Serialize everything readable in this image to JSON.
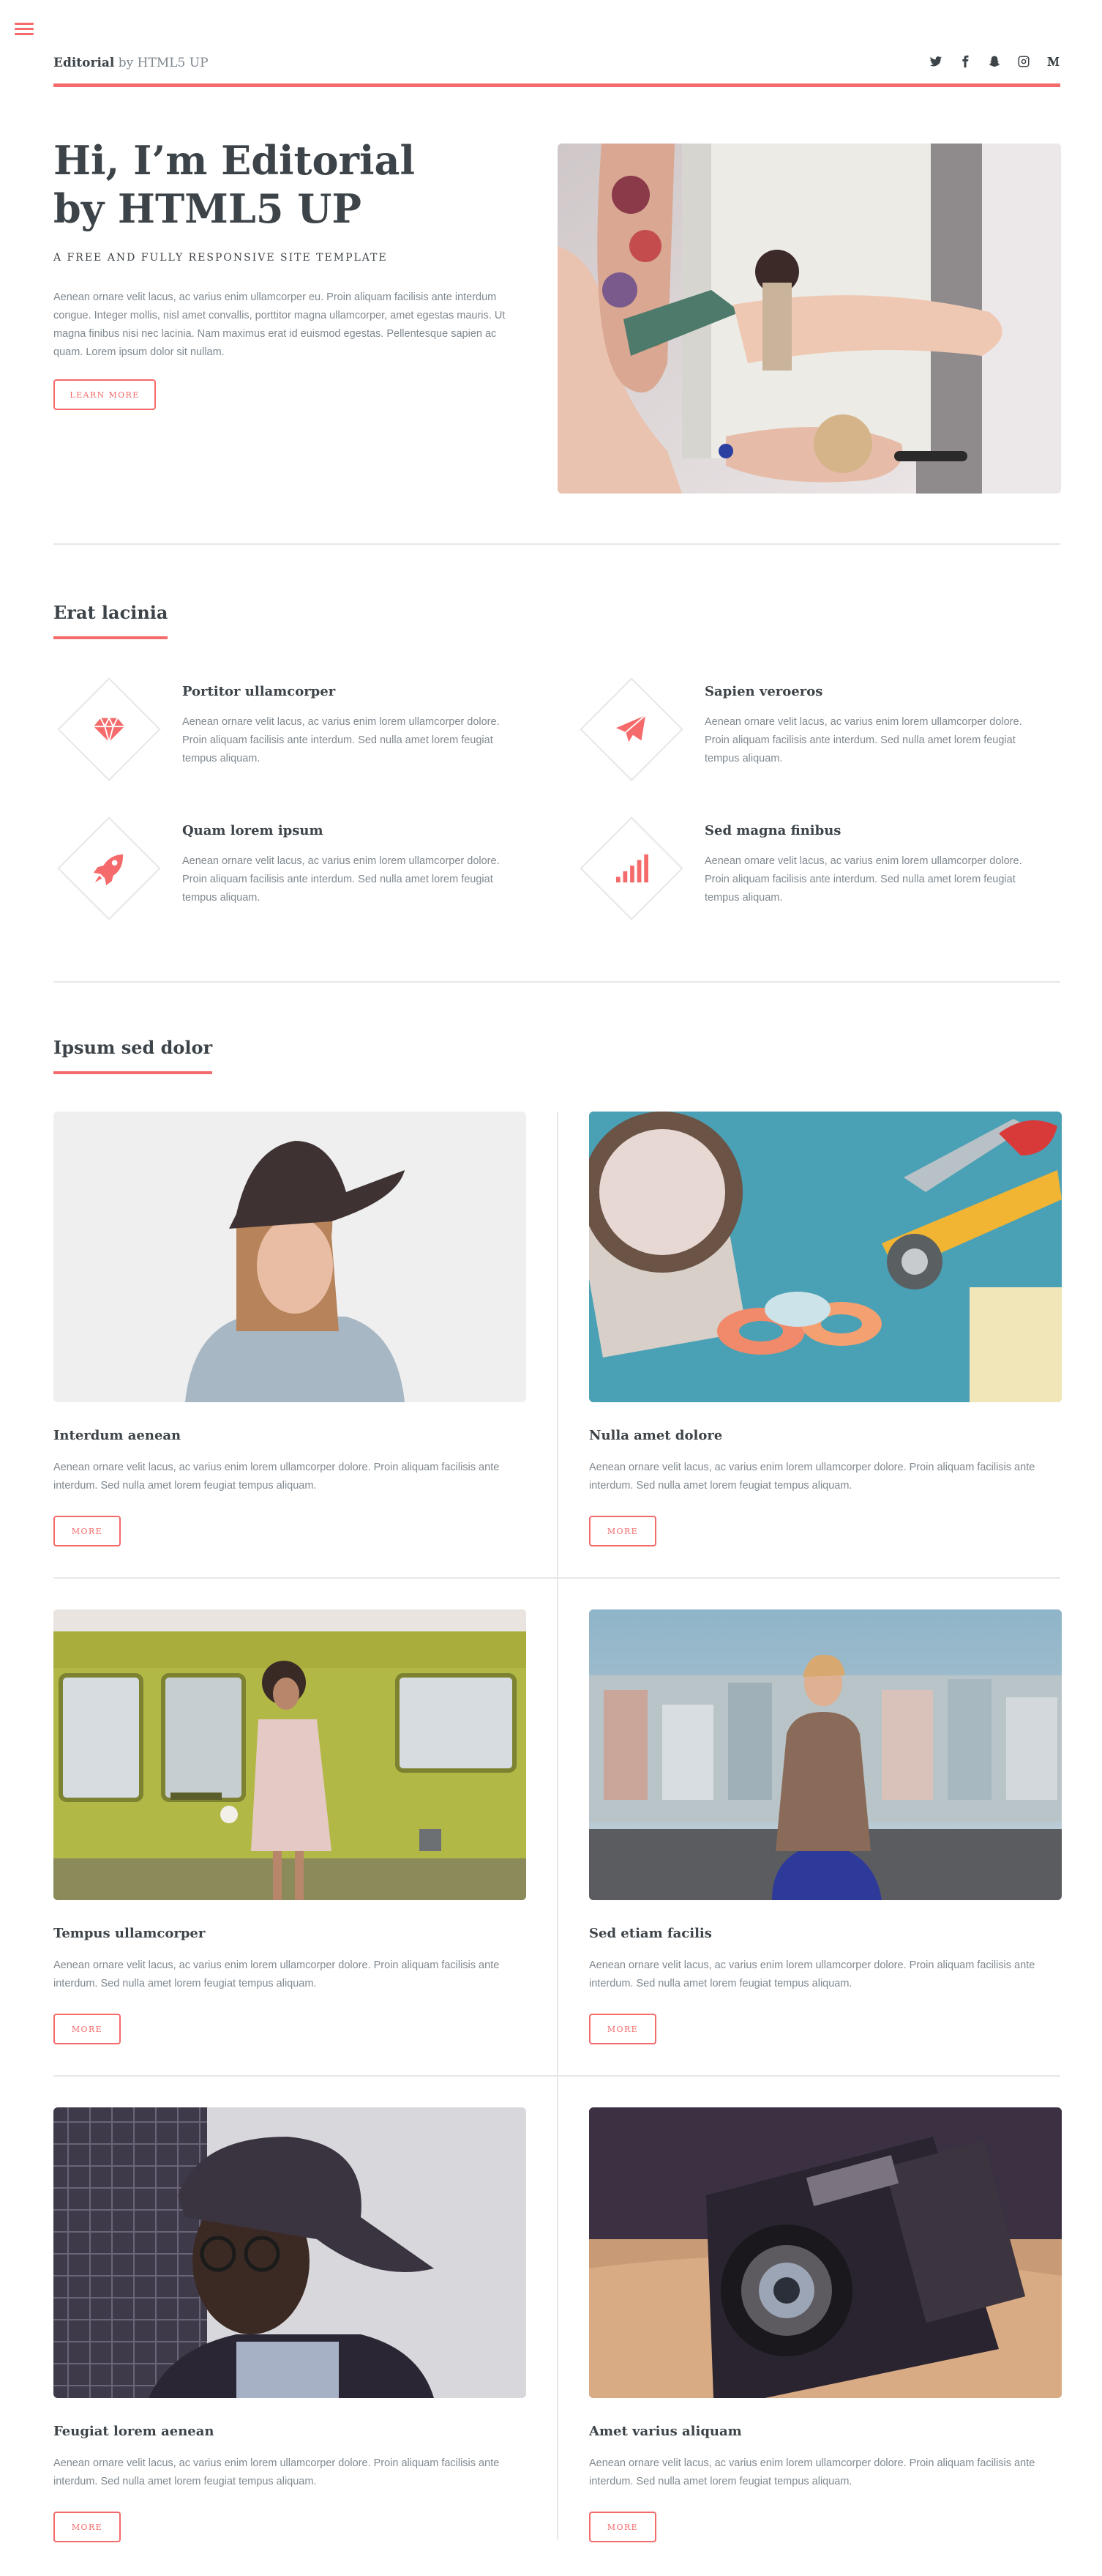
{
  "header": {
    "logo_brand": "Editorial",
    "logo_suffix": " by HTML5 UP"
  },
  "social_icons": [
    "twitter-icon",
    "facebook-icon",
    "snapchat-icon",
    "instagram-icon",
    "medium-icon"
  ],
  "banner": {
    "title_line1": "Hi, I’m Editorial",
    "title_line2": "by HTML5 UP",
    "subtitle": "A FREE AND FULLY RESPONSIVE SITE TEMPLATE",
    "text": "Aenean ornare velit lacus, ac varius enim ullamcorper eu. Proin aliquam facilisis ante interdum congue. Integer mollis, nisl amet convallis, porttitor magna ullamcorper, amet egestas mauris. Ut magna finibus nisi nec lacinia. Nam maximus erat id euismod egestas. Pellentesque sapien ac quam. Lorem ipsum dolor sit nullam.",
    "button": "LEARN MORE"
  },
  "features": {
    "title": "Erat lacinia",
    "items": [
      {
        "title": "Portitor ullamcorper",
        "icon": "diamond-gem-icon",
        "text": "Aenean ornare velit lacus, ac varius enim lorem ullamcorper dolore. Proin aliquam facilisis ante interdum. Sed nulla amet lorem feugiat tempus aliquam."
      },
      {
        "title": "Sapien veroeros",
        "icon": "paper-plane-icon",
        "text": "Aenean ornare velit lacus, ac varius enim lorem ullamcorper dolore. Proin aliquam facilisis ante interdum. Sed nulla amet lorem feugiat tempus aliquam."
      },
      {
        "title": "Quam lorem ipsum",
        "icon": "rocket-icon",
        "text": "Aenean ornare velit lacus, ac varius enim lorem ullamcorper dolore. Proin aliquam facilisis ante interdum. Sed nulla amet lorem feugiat tempus aliquam."
      },
      {
        "title": "Sed magna finibus",
        "icon": "signal-bars-icon",
        "text": "Aenean ornare velit lacus, ac varius enim lorem ullamcorper dolore. Proin aliquam facilisis ante interdum. Sed nulla amet lorem feugiat tempus aliquam."
      }
    ]
  },
  "posts": {
    "title": "Ipsum sed dolor",
    "items": [
      {
        "title": "Interdum aenean",
        "text": "Aenean ornare velit lacus, ac varius enim lorem ullamcorper dolore. Proin aliquam facilisis ante interdum. Sed nulla amet lorem feugiat tempus aliquam.",
        "button": "MORE"
      },
      {
        "title": "Nulla amet dolore",
        "text": "Aenean ornare velit lacus, ac varius enim lorem ullamcorper dolore. Proin aliquam facilisis ante interdum. Sed nulla amet lorem feugiat tempus aliquam.",
        "button": "MORE"
      },
      {
        "title": "Tempus ullamcorper",
        "text": "Aenean ornare velit lacus, ac varius enim lorem ullamcorper dolore. Proin aliquam facilisis ante interdum. Sed nulla amet lorem feugiat tempus aliquam.",
        "button": "MORE"
      },
      {
        "title": "Sed etiam facilis",
        "text": "Aenean ornare velit lacus, ac varius enim lorem ullamcorper dolore. Proin aliquam facilisis ante interdum. Sed nulla amet lorem feugiat tempus aliquam.",
        "button": "MORE"
      },
      {
        "title": "Feugiat lorem aenean",
        "text": "Aenean ornare velit lacus, ac varius enim lorem ullamcorper dolore. Proin aliquam facilisis ante interdum. Sed nulla amet lorem feugiat tempus aliquam.",
        "button": "MORE"
      },
      {
        "title": "Amet varius aliquam",
        "text": "Aenean ornare velit lacus, ac varius enim lorem ullamcorper dolore. Proin aliquam facilisis ante interdum. Sed nulla amet lorem feugiat tempus aliquam.",
        "button": "MORE"
      }
    ]
  },
  "colors": {
    "accent": "#f56a6a",
    "heading": "#3d4449",
    "body_text": "#7f888f",
    "border": "#e5e7e9"
  }
}
